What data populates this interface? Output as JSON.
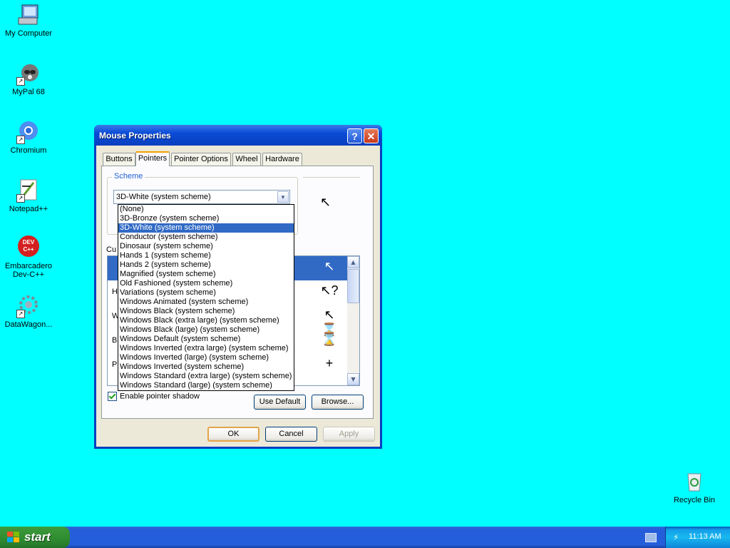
{
  "desktop": {
    "icons": [
      {
        "label": "My Computer"
      },
      {
        "label": "MyPal 68"
      },
      {
        "label": "Chromium"
      },
      {
        "label": "Notepad++"
      },
      {
        "label": "Embarcadero Dev-C++",
        "line1": "Embarcadero",
        "line2": "Dev-C++",
        "badge": "DEV C++"
      },
      {
        "label": "DataWagon..."
      },
      {
        "label": "Recycle Bin"
      }
    ],
    "background": "#00FFFF"
  },
  "window": {
    "title": "Mouse Properties",
    "help_glyph": "?",
    "close_glyph": "✕",
    "tabs": [
      "Buttons",
      "Pointers",
      "Pointer Options",
      "Wheel",
      "Hardware"
    ],
    "active_tab": "Pointers",
    "scheme": {
      "group_label": "Scheme",
      "selected": "3D-White (system scheme)"
    },
    "customize_label": "Cu",
    "pointer_list": {
      "rows": [
        {
          "name": "",
          "icon": "arrow-pointer"
        },
        {
          "name": "H",
          "icon": "help-select-pointer",
          "glyph": "↖?"
        },
        {
          "name": "W",
          "icon": "working-in-background-pointer",
          "glyph": "↖⌛"
        },
        {
          "name": "B",
          "icon": "busy-hourglass-pointer",
          "glyph": "⌛"
        },
        {
          "name": "P",
          "icon": "precision-select-crosshair",
          "glyph": "+"
        }
      ]
    },
    "enable_shadow": {
      "label": "Enable pointer shadow",
      "checked": true
    },
    "use_default_label": "Use Default",
    "browse_label": "Browse...",
    "ok_label": "OK",
    "cancel_label": "Cancel",
    "apply_label": "Apply"
  },
  "scheme_dropdown": {
    "options": [
      "(None)",
      "3D-Bronze (system scheme)",
      "3D-White (system scheme)",
      "Conductor (system scheme)",
      "Dinosaur (system scheme)",
      "Hands 1 (system scheme)",
      "Hands 2 (system scheme)",
      "Magnified (system scheme)",
      "Old Fashioned (system scheme)",
      "Variations (system scheme)",
      "Windows Animated (system scheme)",
      "Windows Black  (system scheme)",
      "Windows Black (extra large) (system scheme)",
      "Windows Black (large) (system scheme)",
      "Windows Default (system scheme)",
      "Windows Inverted (extra large) (system scheme)",
      "Windows Inverted (large) (system scheme)",
      "Windows Inverted (system scheme)",
      "Windows Standard (extra large) (system scheme)",
      "Windows Standard (large) (system scheme)"
    ],
    "selected_index": 2
  },
  "taskbar": {
    "start_label": "start",
    "clock": "11:13 AM"
  }
}
